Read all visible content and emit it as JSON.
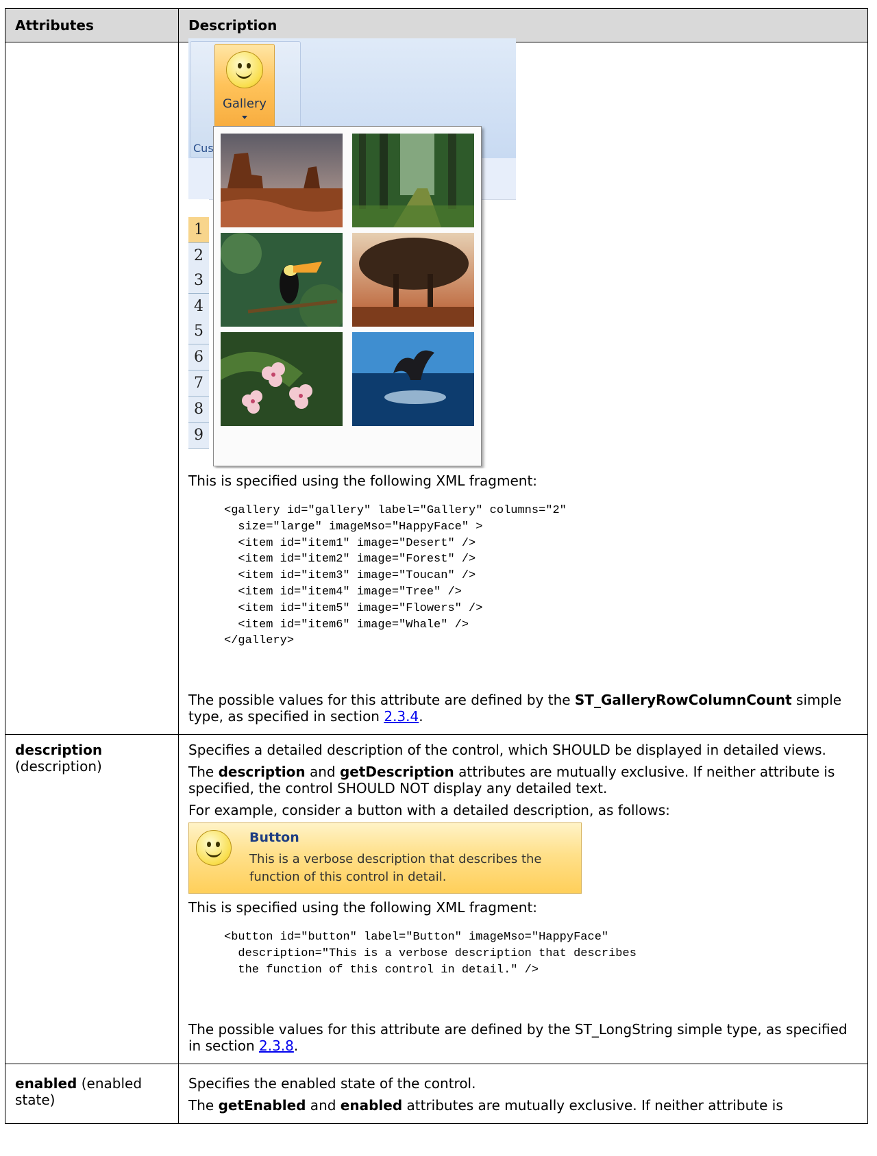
{
  "table": {
    "headers": [
      "Attributes",
      "Description"
    ]
  },
  "row_columns": {
    "gallery_image": {
      "button_label": "Gallery",
      "group_label": "Cus",
      "row_numbers": [
        "1",
        "2",
        "3",
        "4",
        "5",
        "6",
        "7",
        "8",
        "9"
      ],
      "thumbnails": [
        "Desert",
        "Forest",
        "Toucan",
        "Tree",
        "Flowers",
        "Whale"
      ]
    },
    "xml_intro": "This is specified using the following XML fragment:",
    "xml_code": "<gallery id=\"gallery\" label=\"Gallery\" columns=\"2\"\n  size=\"large\" imageMso=\"HappyFace\" >\n  <item id=\"item1\" image=\"Desert\" />\n  <item id=\"item2\" image=\"Forest\" />\n  <item id=\"item3\" image=\"Toucan\" />\n  <item id=\"item4\" image=\"Tree\" />\n  <item id=\"item5\" image=\"Flowers\" />\n  <item id=\"item6\" image=\"Whale\" />\n</gallery>",
    "values_pre": "The possible values for this attribute are defined by the ",
    "values_type": "ST_GalleryRowColumnCount",
    "values_mid": " simple type, as specified in section ",
    "values_link": "2.3.4",
    "values_post": "."
  },
  "row_description": {
    "attr_name": "description",
    "attr_friendly": "(description)",
    "p1": "Specifies a detailed description of the control, which SHOULD be displayed in detailed views.",
    "p2_b1": "description",
    "p2_and": " and ",
    "p2_b2": "getDescription",
    "p2_rest": " attributes are mutually exclusive. If neither attribute is specified, the control SHOULD NOT display any detailed text.",
    "p2_the": "The ",
    "p3": "For example, consider a button with a detailed description, as follows:",
    "button_image": {
      "title": "Button",
      "description": "This is a verbose description that describes the function of this control in detail."
    },
    "xml_intro": "This is specified using the following XML fragment:",
    "xml_code": "<button id=\"button\" label=\"Button\" imageMso=\"HappyFace\"\n  description=\"This is a verbose description that describes\n  the function of this control in detail.\" />",
    "values_pre": "The possible values for this attribute are defined by the ST_LongString simple type, as specified in section ",
    "values_link": "2.3.8",
    "values_post": "."
  },
  "row_enabled": {
    "attr_name": "enabled",
    "attr_friendly": " (enabled state)",
    "p1": "Specifies the enabled state of the control.",
    "p2_the": "The ",
    "p2_b1": "getEnabled",
    "p2_and": " and ",
    "p2_b2": "enabled",
    "p2_rest": " attributes are mutually exclusive. If neither attribute is"
  }
}
